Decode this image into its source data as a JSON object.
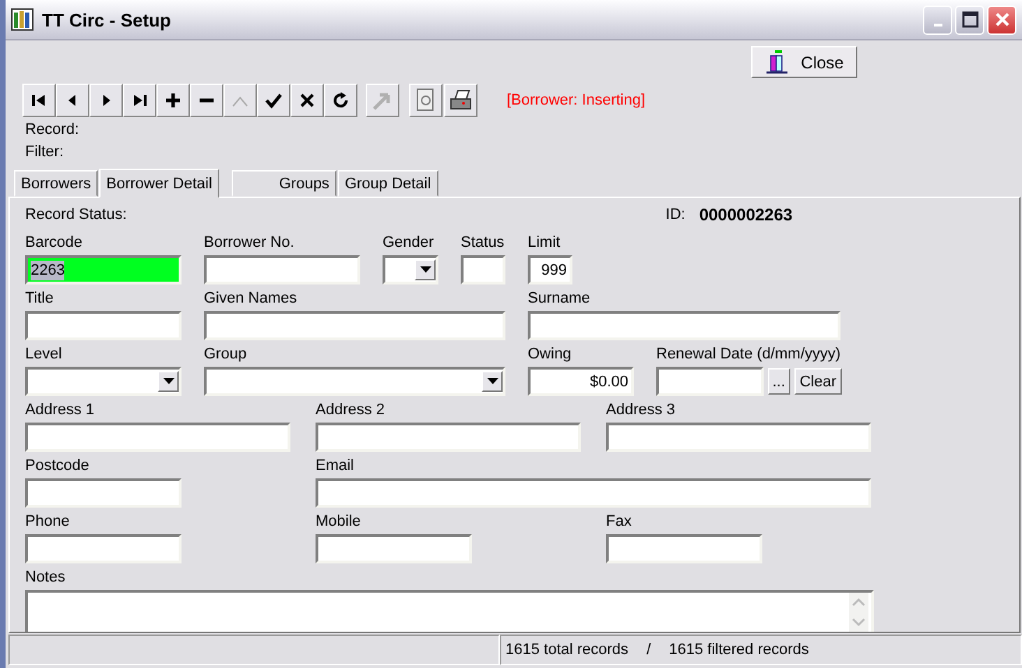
{
  "window": {
    "title": "TT Circ - Setup"
  },
  "close_button": "Close",
  "navigator": [
    {
      "kind": "first",
      "disabled": false
    },
    {
      "kind": "prior",
      "disabled": false
    },
    {
      "kind": "next",
      "disabled": false
    },
    {
      "kind": "last",
      "disabled": false
    },
    {
      "kind": "insert",
      "disabled": false
    },
    {
      "kind": "delete",
      "disabled": false
    },
    {
      "kind": "edit",
      "disabled": true
    },
    {
      "kind": "post",
      "disabled": false
    },
    {
      "kind": "cancel",
      "disabled": false
    },
    {
      "kind": "refresh",
      "disabled": false
    }
  ],
  "tools": [
    {
      "kind": "export",
      "disabled": true
    },
    {
      "kind": "preview",
      "disabled": false
    },
    {
      "kind": "print",
      "disabled": false
    }
  ],
  "mode_status": "[Borrower: Inserting]",
  "record_label": "Record:",
  "filter_label": "Filter:",
  "tabs": [
    {
      "label": "Borrowers",
      "selected": false
    },
    {
      "label": "Borrower Detail",
      "selected": true
    },
    {
      "label": "Groups",
      "selected": false
    },
    {
      "label": "Group Detail",
      "selected": false
    }
  ],
  "record_status_label": "Record Status:",
  "id_label": "ID:",
  "id_value": "0000002263",
  "form_rows": [
    [
      {
        "label": "Barcode",
        "kind": "text",
        "value": "2263",
        "focused": true
      },
      {
        "label": "Borrower No.",
        "kind": "text",
        "focused": false
      },
      {
        "label": "Gender",
        "kind": "combo",
        "focused": false
      },
      {
        "label": "Status",
        "kind": "text",
        "focused": false
      },
      {
        "label": "Limit",
        "kind": "number",
        "value": "999",
        "focused": false
      }
    ],
    [
      {
        "label": "Title",
        "kind": "text",
        "focused": false
      },
      {
        "label": "Given Names",
        "kind": "text",
        "focused": false
      },
      {
        "label": "Surname",
        "kind": "text",
        "focused": false
      }
    ],
    [
      {
        "label": "Level",
        "kind": "combo",
        "focused": false
      },
      {
        "label": "Group",
        "kind": "combo",
        "focused": false
      },
      {
        "label": "Owing",
        "kind": "number",
        "value": "$0.00",
        "focused": false
      },
      {
        "label": "Renewal Date (d/mm/yyyy)",
        "kind": "date",
        "browse": "...",
        "clear": "Clear",
        "focused": false
      }
    ],
    [
      {
        "label": "Address 1",
        "kind": "text",
        "focused": false
      },
      {
        "label": "Address 2",
        "kind": "text",
        "focused": false
      },
      {
        "label": "Address 3",
        "kind": "text",
        "focused": false
      }
    ],
    [
      {
        "label": "Postcode",
        "kind": "text",
        "focused": false
      },
      {
        "label": "Email",
        "kind": "text",
        "focused": false
      }
    ],
    [
      {
        "label": "Phone",
        "kind": "text",
        "focused": false
      },
      {
        "label": "Mobile",
        "kind": "text",
        "focused": false
      },
      {
        "label": "Fax",
        "kind": "text",
        "focused": false
      }
    ],
    [
      {
        "label": "Notes",
        "kind": "memo",
        "focused": false
      }
    ]
  ],
  "status_bar": {
    "total": "1615 total records",
    "separator": "/",
    "filtered": "1615 filtered records"
  }
}
